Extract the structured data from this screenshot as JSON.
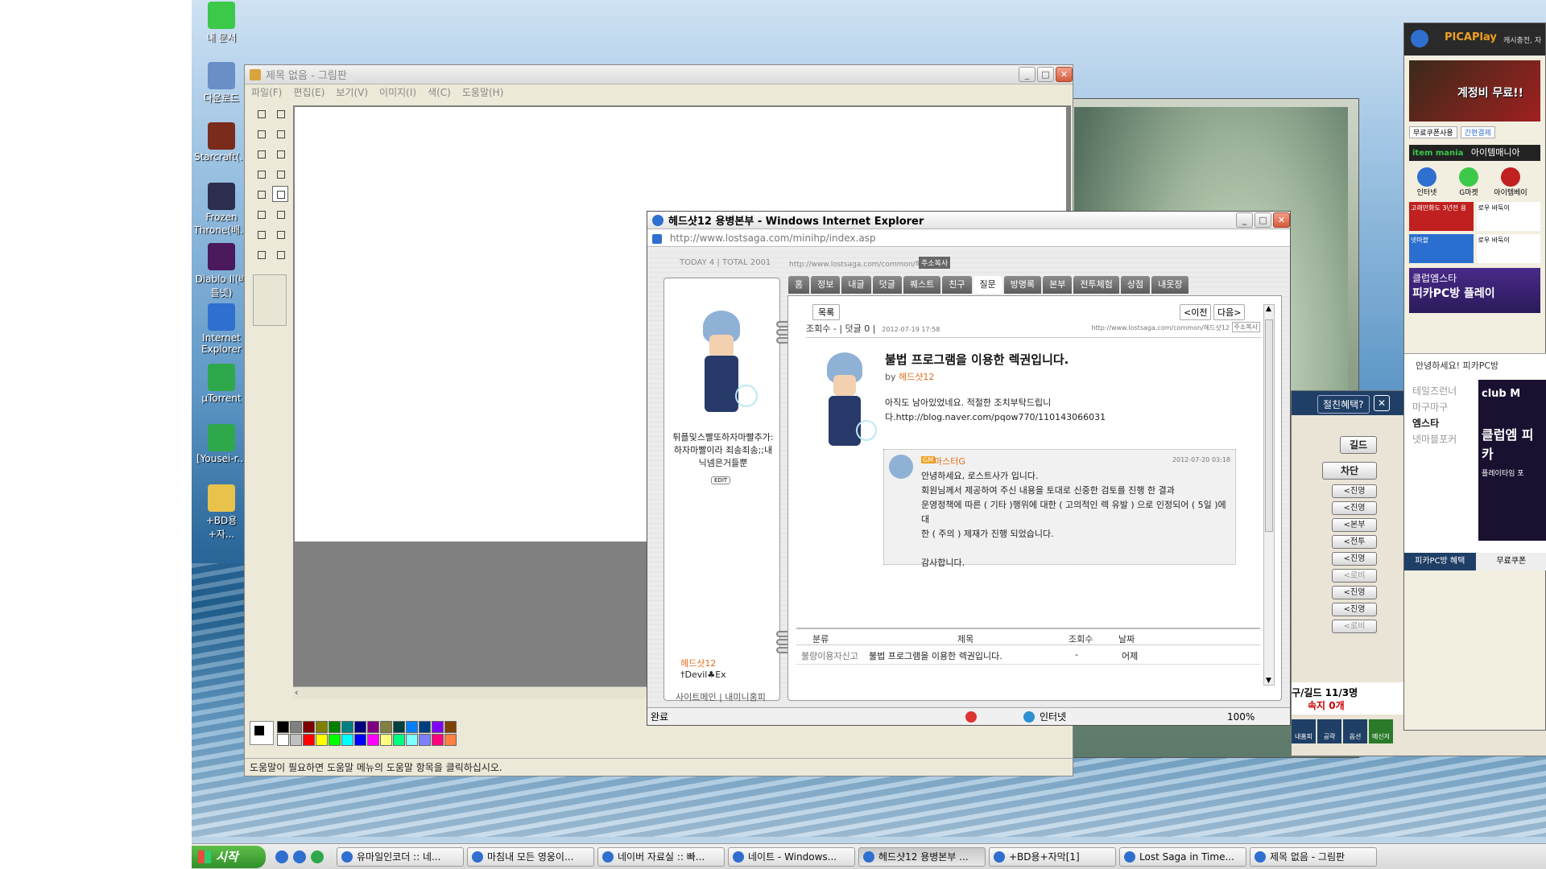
{
  "desktop": {
    "icons": [
      {
        "label": "내 문서",
        "color": "#3cc94a"
      },
      {
        "label": "다운로드",
        "color": "#6a8fc7"
      },
      {
        "label": "Starcraft(...",
        "color": "#7a2b1c"
      },
      {
        "label": "Frozen Throne(배...",
        "color": "#2d2d50"
      },
      {
        "label": "Diablo II(배틀넷)",
        "color": "#4b1a5c"
      },
      {
        "label": "Internet Explorer",
        "color": "#2f6fcf"
      },
      {
        "label": "µTorrent",
        "color": "#2ea84a"
      },
      {
        "label": "[Yousei-r...",
        "color": "#2ea84a"
      },
      {
        "label": "+BD용+자...",
        "color": "#e8c24a"
      }
    ]
  },
  "paint": {
    "title": "제목 없음 - 그림판",
    "menu": [
      "파일(F)",
      "편집(E)",
      "보기(V)",
      "이미지(I)",
      "색(C)",
      "도움말(H)"
    ],
    "status": "도움말이 필요하면 도움말 메뉴의 도움말 항목을 클릭하십시오.",
    "palette": [
      "#000000",
      "#808080",
      "#800000",
      "#808000",
      "#008000",
      "#008080",
      "#000080",
      "#800080",
      "#808040",
      "#004040",
      "#0080ff",
      "#004080",
      "#8000ff",
      "#804000",
      "#ffffff",
      "#c0c0c0",
      "#ff0000",
      "#ffff00",
      "#00ff00",
      "#00ffff",
      "#0000ff",
      "#ff00ff",
      "#ffff80",
      "#00ff80",
      "#80ffff",
      "#8080ff",
      "#ff0080",
      "#ff8040"
    ]
  },
  "ie": {
    "title": "헤드샷12 용병본부 - Windows Internet Explorer",
    "address": "http://www.lostsaga.com/minihp/index.asp",
    "today": "TODAY 4 | TOTAL 2001",
    "url_small": "http://www.lostsaga.com/common/헤드샷12",
    "copy_addr": "주소복사",
    "tabs": [
      "홈",
      "정보",
      "내글",
      "덧글",
      "퀘스트",
      "친구",
      "질문",
      "방명록",
      "본부",
      "전투체험",
      "상점",
      "내옷장"
    ],
    "selected_tab": "질문",
    "profile_text": "튀플및스빨또하자마빨추가: 하자마빨이라 죄송죄송;;내닉넴은거들뿐",
    "edit": "EDIT",
    "owner": "헤드샷12",
    "guild": "†Devil♣Ex",
    "footer_links": "사이트메인 | 내미니홈피",
    "list_button": "목록",
    "prev_button": "<이전",
    "next_button": "다음>",
    "views_line": "조회수 - | 덧글 0 |",
    "post_date": "2012-07-19 17:58",
    "post_title": "불법 프로그램을 이용한 렉권입니다.",
    "post_by": "by",
    "post_author": "헤드샷12",
    "post_body_1": "아직도 남아있었네요. 적절한 조치부탁드립니",
    "post_body_2": "다.http://blog.naver.com/pqow770/110143066031",
    "reply_author": "마스터G",
    "reply_date": "2012-07-20 03:18",
    "reply_lines": [
      "안녕하세요, 로스트사가 입니다.",
      "회원님께서 제공하여 주신 내용을 토대로 신중한 검토를 진행 한 결과",
      "운영정책에 따른 ( 기타 )행위에 대한 ( 고의적인 렉 유발 ) 으로 인정되어 ( 5일 )에 대",
      "한 ( 주의 ) 제재가 진행 되었습니다.",
      "",
      "감사합니다."
    ],
    "table_headers": [
      "분류",
      "제목",
      "조회수",
      "날짜"
    ],
    "table_row": [
      "불량이용자신고",
      "불법 프로그램을 이용한 렉권입니다.",
      "-",
      "어제"
    ],
    "status_done": "완료",
    "status_zone": "인터넷",
    "zoom": "100%"
  },
  "game_panel": {
    "popup_title": "절친혜택?",
    "tabs": [
      "길드",
      "차단"
    ],
    "buttons": [
      "<진영",
      "<진영",
      "<본부",
      "<전투",
      "<진영",
      "<로비",
      "<진영",
      "<진영",
      "<로비"
    ],
    "footer_text": "구/길드 11/3명",
    "footer_sub": "속지 0개",
    "bottom_icons": [
      "내홈피",
      "공략",
      "옵션",
      "메신저"
    ]
  },
  "ad_panel": {
    "brand": "PICAPlay",
    "header_links": "캐시충전, 자",
    "game_banner": "계정비 무료!!",
    "banner_links": [
      "무료쿠폰사용",
      "간편결제"
    ],
    "site_1": "아이템매니아",
    "site_1_logo": "item mania",
    "shortcuts": [
      "인터넷",
      "G마켓",
      "아이템베이"
    ],
    "game_1": "고래만화도 3년전 용",
    "game_2": "로우 바둑이",
    "game_3": "로우 바둑이",
    "game_4": "넷마블",
    "club_title": "클럽엠스타",
    "club_sub": "피카PC방 플레이",
    "greeting": "안녕하세요! 피카PC방",
    "menu": [
      "테일즈런너",
      "마구마구",
      "엠스타",
      "넷마블포커"
    ],
    "club_logo": "club M",
    "club_text": "클럽엠 피카",
    "club_text2": "플레이타임 포",
    "bottom_tabs": [
      "피카PC방 혜택",
      "무료쿠폰"
    ]
  },
  "taskbar": {
    "start": "시작",
    "items": [
      "유마일인코더 :: 네...",
      "마침내 모든 영웅이...",
      "네이버 자료실 :: 빠...",
      "네이트 - Windows...",
      "헤드샷12 용병본부 ...",
      "+BD용+자막[1]",
      "Lost Saga in Time...",
      "제목 없음 - 그림판"
    ],
    "active_index": 4
  }
}
